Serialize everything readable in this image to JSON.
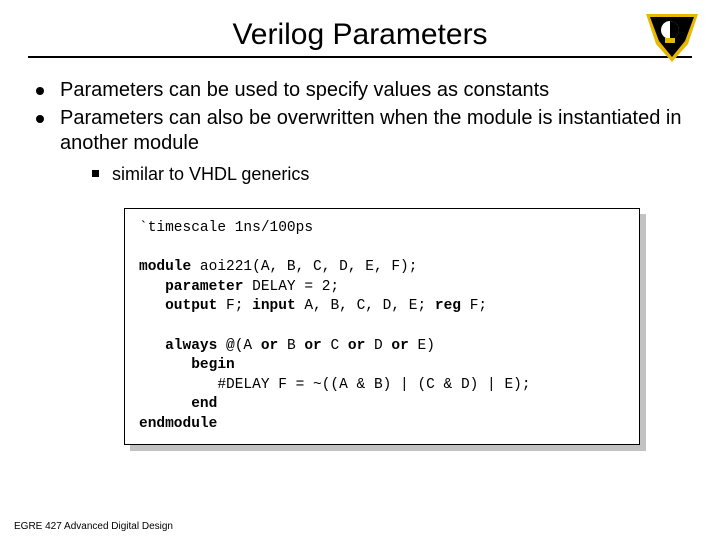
{
  "title": "Verilog Parameters",
  "bullets": [
    "Parameters can be used to specify values as constants",
    "Parameters can also be overwritten when the module is instantiated in another module"
  ],
  "subbullet": "similar to VHDL generics",
  "code": {
    "l1": "`timescale 1ns/100ps",
    "l2a": "module",
    "l2b": " aoi221(A, B, C, D, E, F);",
    "l3a": "   parameter",
    "l3b": " DELAY = 2;",
    "l4a": "   output",
    "l4b": " F; ",
    "l4c": "input",
    "l4d": " A, B, C, D, E; ",
    "l4e": "reg",
    "l4f": " F;",
    "l5a": "   always",
    "l5b": " @(A ",
    "l5c": "or",
    "l5d": " B ",
    "l5e": "or",
    "l5f": " C ",
    "l5g": "or",
    "l5h": " D ",
    "l5i": "or",
    "l5j": " E)",
    "l6a": "      begin",
    "l7": "         #DELAY F = ~((A & B) | (C & D) | E);",
    "l8a": "      end",
    "l9a": "endmodule"
  },
  "footer": "EGRE 427 Advanced Digital Design"
}
